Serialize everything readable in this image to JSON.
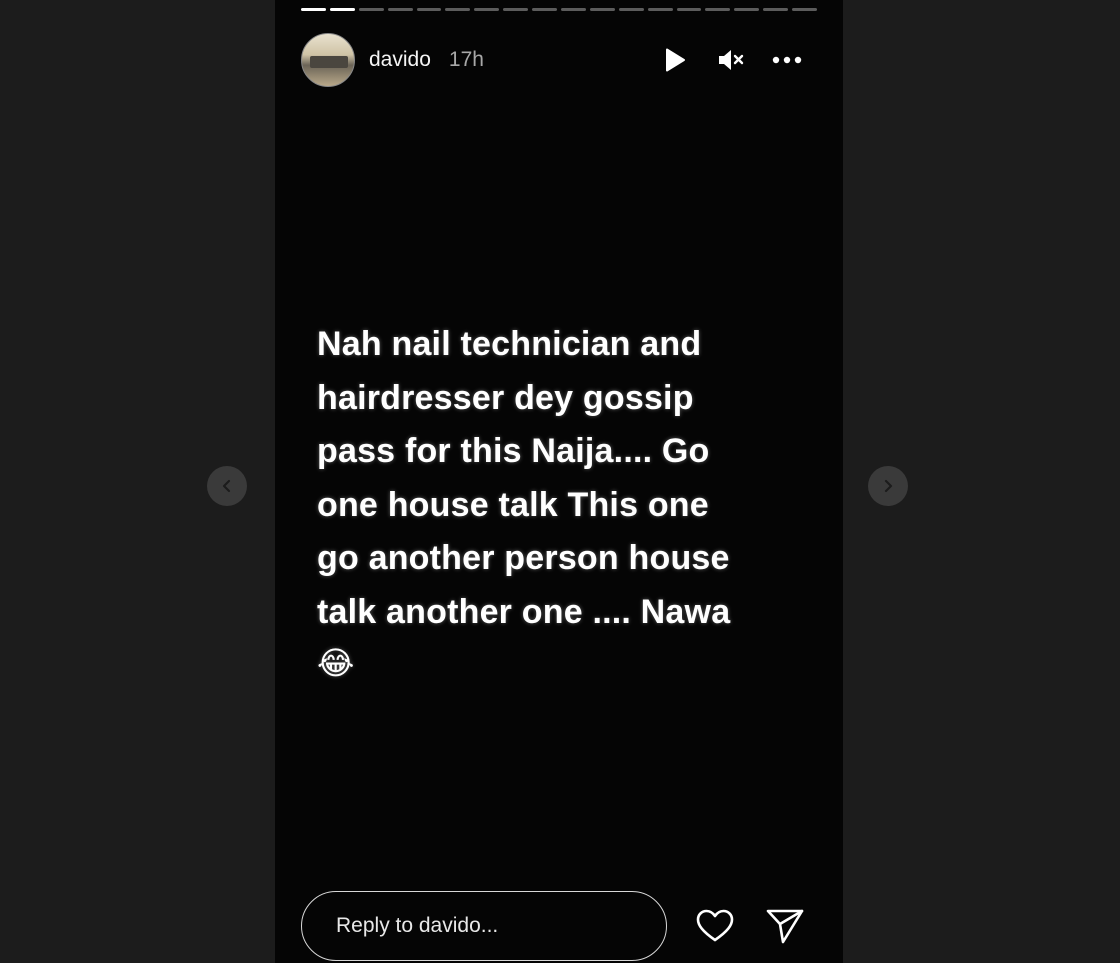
{
  "story": {
    "segments_total": 18,
    "segments_completed": 2,
    "username": "davido",
    "time_ago": "17h",
    "text_lines": [
      "Nah nail technician and",
      "hairdresser dey gossip",
      "pass for this Naija.... Go",
      "one house talk This one",
      "go another person house",
      "talk another one .... Nawa"
    ],
    "emoji": "😂"
  },
  "controls": {
    "play_icon": "play-icon",
    "mute_icon": "muted-speaker-icon",
    "more_icon": "more-options-icon"
  },
  "reply": {
    "placeholder": "Reply to davido..."
  },
  "actions": {
    "like_icon": "heart-icon",
    "share_icon": "send-icon"
  },
  "navigation": {
    "prev_icon": "chevron-left-icon",
    "next_icon": "chevron-right-icon"
  },
  "colors": {
    "viewer_bg": "#1c1c1c",
    "story_bg": "#050505",
    "text": "#ffffff",
    "muted_text": "#a8a8a8"
  }
}
